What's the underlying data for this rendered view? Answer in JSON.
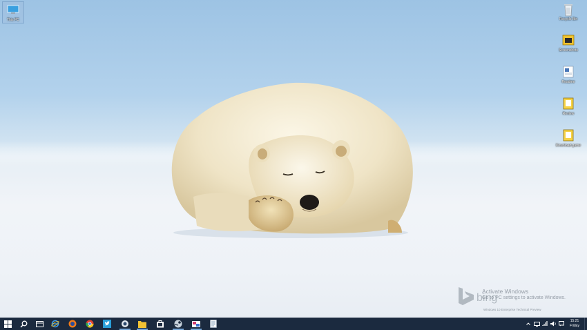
{
  "desktop": {
    "icons": [
      {
        "name": "this-pc",
        "label": "This PC",
        "icon": "monitor-icon"
      },
      {
        "name": "recycle-bin",
        "label": "Recycle Bin",
        "icon": "recycle-bin-icon"
      },
      {
        "name": "screenshots",
        "label": "Screenshots",
        "icon": "folder-icon"
      },
      {
        "name": "readme",
        "label": "Readme",
        "icon": "document-icon"
      },
      {
        "name": "review",
        "label": "Review",
        "icon": "document-icon"
      },
      {
        "name": "downloads",
        "label": "Download game",
        "icon": "document-icon"
      }
    ],
    "watermark": {
      "brand": "bing",
      "line1": "Activate Windows",
      "line2": "Go to PC settings to activate Windows.",
      "build": "Windows 10 Enterprise Technical Preview"
    }
  },
  "taskbar": {
    "pinned": [
      {
        "name": "start",
        "icon": "windows-logo-icon"
      },
      {
        "name": "search",
        "icon": "search-icon"
      },
      {
        "name": "task-view",
        "icon": "task-view-icon"
      },
      {
        "name": "internet-explorer",
        "icon": "ie-icon"
      },
      {
        "name": "firefox",
        "icon": "firefox-icon"
      },
      {
        "name": "chrome",
        "icon": "chrome-icon"
      },
      {
        "name": "twitter",
        "icon": "twitter-icon"
      },
      {
        "name": "app-circle",
        "icon": "app-icon"
      },
      {
        "name": "file-explorer",
        "icon": "folder-icon"
      },
      {
        "name": "store",
        "icon": "store-icon"
      },
      {
        "name": "steam",
        "icon": "steam-icon"
      },
      {
        "name": "paint",
        "icon": "paint-icon"
      },
      {
        "name": "notepad",
        "icon": "notepad-icon"
      }
    ],
    "clock": {
      "time": "15:21",
      "day": "Friday"
    },
    "colors": {
      "taskbar": "#1b2a3f",
      "accent": "#76a7d8"
    }
  }
}
